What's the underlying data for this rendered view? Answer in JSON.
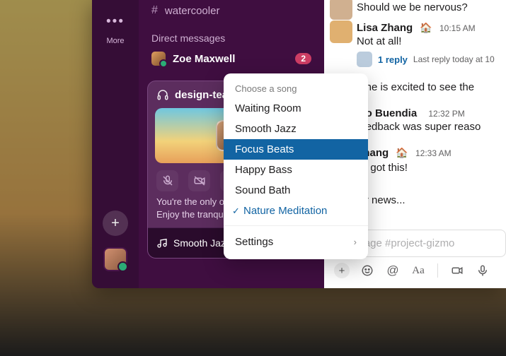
{
  "rail": {
    "more": "More"
  },
  "sidebar": {
    "channel": "watercooler",
    "dm_header": "Direct messages",
    "dm_name": "Zoe Maxwell",
    "dm_badge": "2"
  },
  "huddle": {
    "title": "design-team",
    "note_line1": "You're the only one here.",
    "note_line2": "Enjoy the tranquility.",
    "song": "Smooth Jazz"
  },
  "dropdown": {
    "title": "Choose a song",
    "items": [
      "Waiting Room",
      "Smooth Jazz",
      "Focus Beats",
      "Happy Bass",
      "Sound Bath",
      "Nature Meditation"
    ],
    "highlight_index": 2,
    "selected_index": 5,
    "settings": "Settings"
  },
  "messages": {
    "m0_body": "Should we be nervous?",
    "m1_name": "Lisa Zhang",
    "m1_time": "10:15 AM",
    "m1_body": "Not at all!",
    "m1_reply": "1 reply",
    "m1_reply_meta": "Last reply today at 10",
    "m2_body": "Everyone is excited to see the",
    "m3_name": "Arcadio Buendia",
    "m3_time": "12:32 PM",
    "m3_body": "That feedback was super reaso",
    "m4_name": "Lisa Zhang",
    "m4_time": "12:33 AM",
    "m4_body": "You got this!",
    "m5_body": "In other news..."
  },
  "composer": {
    "placeholder": "Message #project-gizmo"
  }
}
